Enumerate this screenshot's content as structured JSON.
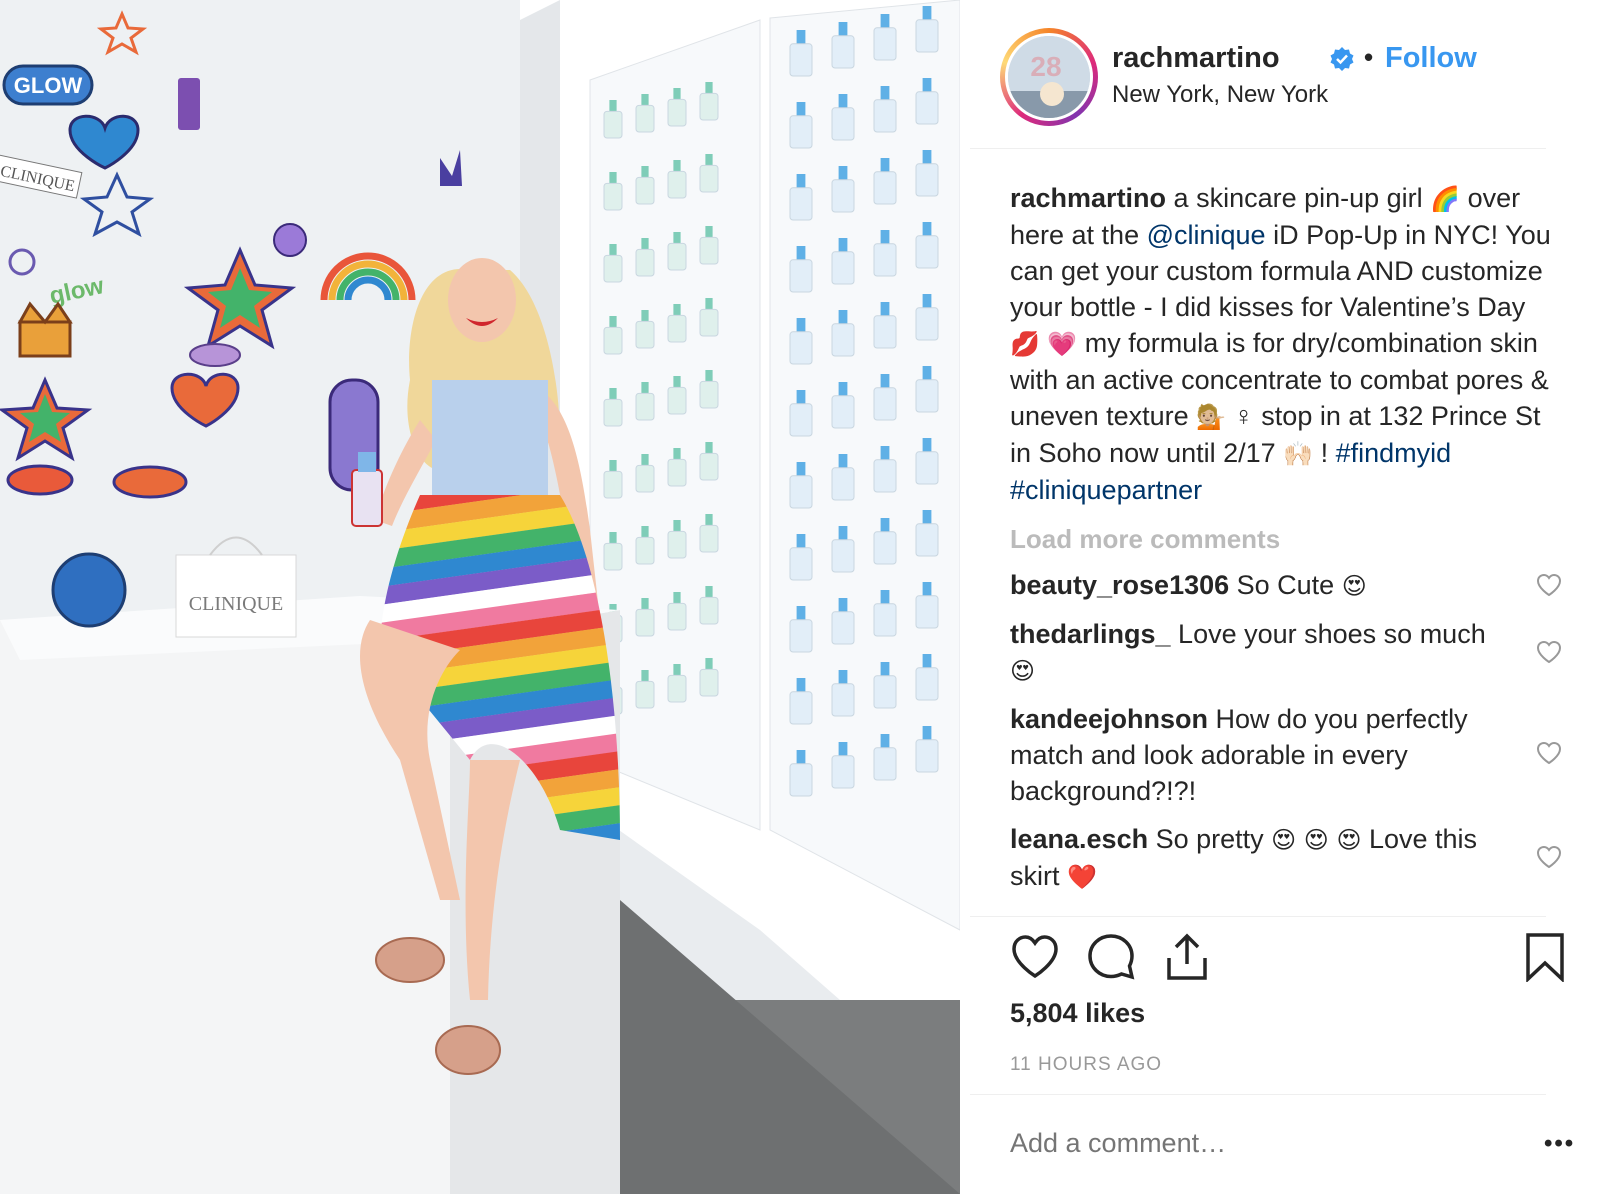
{
  "post": {
    "username": "rachmartino",
    "follow_label": "Follow",
    "separator": "•",
    "location": "New York, New York",
    "avatar_text": "28"
  },
  "caption": {
    "user": "rachmartino",
    "part1": " a skincare pin-up girl ",
    "emoji_rainbow": "🌈",
    "part2": "  over here at the ",
    "mention": "@clinique",
    "part3": " iD Pop-Up in NYC! You can get your custom formula AND customize your bottle - I did kisses for Valentine’s Day ",
    "emoji_kiss": "💋",
    "emoji_heart": "💗",
    "part4": "  my formula is for dry/combination skin with an active concentrate to combat pores & uneven texture ",
    "emoji_woman": "💁🏼",
    "part5": "♀ stop in at 132 Prince St in Soho now until 2/17 ",
    "emoji_hands": "🙌🏻",
    "part6": " ! ",
    "hashtag1": "#findmyid",
    "hashtag2": "#cliniquepartner"
  },
  "load_more": "Load more comments",
  "comments": [
    {
      "user": "beauty_rose1306",
      "text": " So Cute ",
      "emoji": "😍"
    },
    {
      "user": "thedarlings_",
      "text": " Love your shoes so much ",
      "emoji": "😍"
    },
    {
      "user": "kandeejohnson",
      "text": " How do you perfectly match and look adorable in every background?!?!",
      "emoji": ""
    },
    {
      "user": "leana.esch",
      "text": " So pretty ",
      "emoji": "😍 😍 😍",
      "text2": "  Love this skirt ",
      "emoji2": "❤️"
    }
  ],
  "likes": "5,804 likes",
  "time": "11 HOURS AGO",
  "add_comment_placeholder": "Add a comment…",
  "more_label": "•••",
  "photo_text": {
    "glow_badge": "GLOW",
    "clinique_strip": "CLINIQUE",
    "glow_script": "glow",
    "bag_brand": "CLINIQUE"
  },
  "colors": {
    "accent": "#3897f0",
    "link": "#003569",
    "muted": "#999999",
    "load_more": "#bbbbbb"
  }
}
